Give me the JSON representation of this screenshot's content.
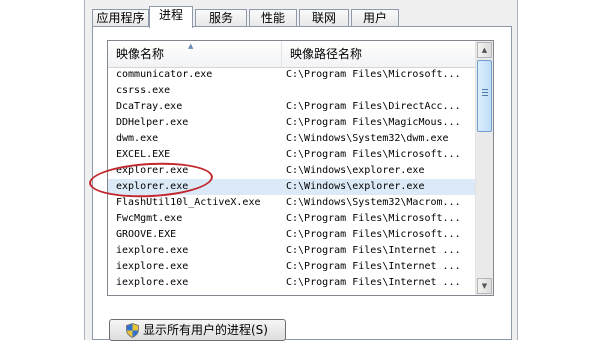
{
  "tabs": [
    {
      "label": "应用程序",
      "active": false
    },
    {
      "label": "进程",
      "active": true
    },
    {
      "label": "服务",
      "active": false
    },
    {
      "label": "性能",
      "active": false
    },
    {
      "label": "联网",
      "active": false
    },
    {
      "label": "用户",
      "active": false
    }
  ],
  "columns": {
    "image_name": "映像名称",
    "image_path": "映像路径名称"
  },
  "rows": [
    {
      "name": "communicator.exe",
      "path": "C:\\Program Files\\Microsoft..."
    },
    {
      "name": "csrss.exe",
      "path": ""
    },
    {
      "name": "DcaTray.exe",
      "path": "C:\\Program Files\\DirectAcc..."
    },
    {
      "name": "DDHelper.exe",
      "path": "C:\\Program Files\\MagicMous..."
    },
    {
      "name": "dwm.exe",
      "path": "C:\\Windows\\System32\\dwm.exe"
    },
    {
      "name": "EXCEL.EXE",
      "path": "C:\\Program Files\\Microsoft..."
    },
    {
      "name": "explorer.exe",
      "path": "C:\\Windows\\explorer.exe"
    },
    {
      "name": "explorer.exe",
      "path": "C:\\Windows\\explorer.exe",
      "selected": true
    },
    {
      "name": "FlashUtil10l_ActiveX.exe",
      "path": "C:\\Windows\\System32\\Macrom..."
    },
    {
      "name": "FwcMgmt.exe",
      "path": "C:\\Program Files\\Microsoft..."
    },
    {
      "name": "GROOVE.EXE",
      "path": "C:\\Program Files\\Microsoft..."
    },
    {
      "name": "iexplore.exe",
      "path": "C:\\Program Files\\Internet ..."
    },
    {
      "name": "iexplore.exe",
      "path": "C:\\Program Files\\Internet ..."
    },
    {
      "name": "iexplore.exe",
      "path": "C:\\Program Files\\Internet ..."
    }
  ],
  "show_all_button": {
    "label": "显示所有用户的进程(S)"
  },
  "colors": {
    "selection": "#dceaf8",
    "annotation": "#c1272d",
    "scroll_thumb": "#bfdcf7"
  }
}
